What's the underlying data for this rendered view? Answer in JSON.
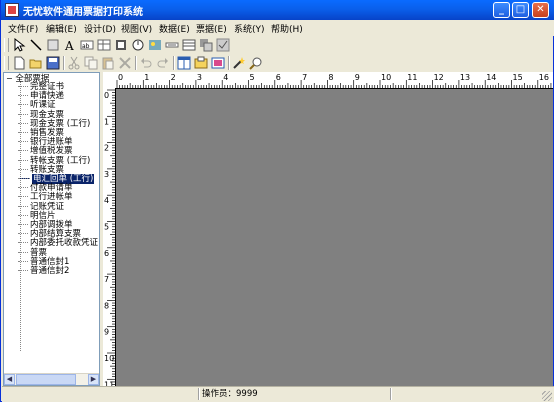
{
  "window": {
    "title": "无忧软件通用票据打印系统",
    "buttons": {
      "minimize": "_",
      "maximize": "□",
      "close": "✕"
    }
  },
  "menubar": {
    "items": [
      {
        "label": "文件(F)"
      },
      {
        "label": "编辑(E)"
      },
      {
        "label": "设计(D)"
      },
      {
        "label": "视图(V)"
      },
      {
        "label": "数据(E)"
      },
      {
        "label": "票据(E)"
      },
      {
        "label": "系统(Y)"
      },
      {
        "label": "帮助(H)"
      }
    ]
  },
  "toolbar1": {
    "icons": [
      "pointer-icon",
      "line-icon",
      "rectangle-icon",
      "text-icon",
      "label-field-icon",
      "table-icon",
      "barcode-icon",
      "image-icon",
      "picture-icon",
      "hline-icon",
      "grid-icon",
      "multi-icon",
      "check-icon"
    ]
  },
  "toolbar2": {
    "icons": [
      "new-icon",
      "open-icon",
      "save-icon",
      "cut-icon",
      "copy-icon",
      "paste-icon",
      "delete-icon",
      "undo-icon",
      "redo-icon",
      "layout-icon",
      "export-icon",
      "preview-icon",
      "wand-icon",
      "zoom-icon"
    ]
  },
  "tree": {
    "root": "全部票据",
    "items": [
      "完整证书",
      "申请快递",
      "听课证",
      "现金支票",
      "现金支票 (工行)",
      "销售发票",
      "银行进账单",
      "增值税发票",
      "转帐支票 (工行)",
      "转账支票",
      "电汇回单 (工行)",
      "付款申请单",
      "工行进帐单",
      "记账凭证",
      "明信片",
      "内部调拨单",
      "内部结算支票",
      "内部委托收款凭证",
      "普票",
      "普通信封1",
      "普通信封2"
    ],
    "selected_index": 10
  },
  "ruler": {
    "h_numbers": [
      "0",
      "1",
      "2",
      "3",
      "4",
      "5",
      "6",
      "7",
      "8",
      "9",
      "10",
      "11",
      "12",
      "13",
      "14",
      "15",
      "16"
    ],
    "v_numbers": [
      "0",
      "1",
      "2",
      "3",
      "4",
      "5",
      "6",
      "7",
      "8",
      "9",
      "10",
      "11"
    ]
  },
  "status": {
    "operator": "操作员：9999"
  },
  "colors": {
    "titlebar": "#0A5FEB",
    "canvas": "#808080",
    "selection": "#0A246A"
  }
}
